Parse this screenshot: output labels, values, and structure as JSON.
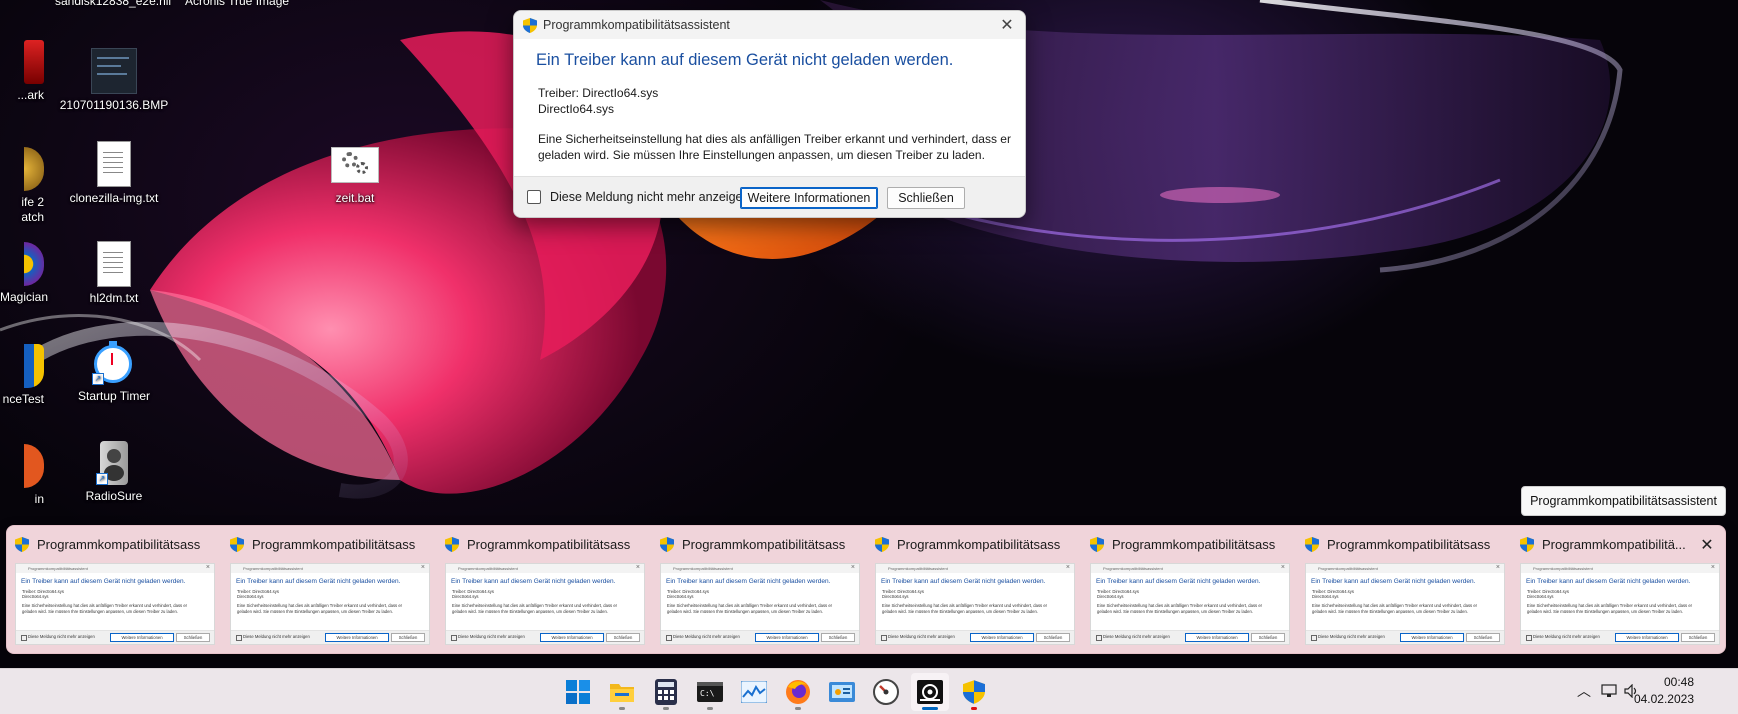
{
  "desktop": {
    "icons": [
      {
        "label": "...ark",
        "kind": "partial-red"
      },
      {
        "label": "210701190136.BMP",
        "kind": "bmp"
      },
      {
        "label": "ife 2\natch",
        "kind": "partial-gold"
      },
      {
        "label": "clonezilla-img.txt",
        "kind": "txt"
      },
      {
        "label": "zeit.bat",
        "kind": "bat"
      },
      {
        "label": "Magician",
        "kind": "partial-shield"
      },
      {
        "label": "hl2dm.txt",
        "kind": "txt"
      },
      {
        "label": "nceTest",
        "kind": "partial-shield"
      },
      {
        "label": "Startup Timer",
        "kind": "timer"
      },
      {
        "label": "in",
        "kind": "partial-orange"
      },
      {
        "label": "RadioSure",
        "kind": "speaker"
      }
    ],
    "top_partial_labels": [
      "sandisk12838_e2e.hll",
      "Acronis True Image"
    ]
  },
  "dialog": {
    "window_title": "Programmkompatibilitätsassistent",
    "heading": "Ein Treiber kann auf diesem Gerät nicht geladen werden.",
    "driver_line1": "Treiber: DirectIo64.sys",
    "driver_line2": "DirectIo64.sys",
    "message_line1": "Eine Sicherheitseinstellung hat dies als anfälligen Treiber erkannt und verhindert, dass er",
    "message_line2": "geladen wird. Sie müssen Ihre Einstellungen anpassen, um diesen Treiber zu laden.",
    "checkbox_label": "Diese Meldung nicht mehr anzeigen",
    "more_info_button": "Weitere Informationen",
    "close_button": "Schließen"
  },
  "tooltip": "Programmkompatibilitätsassistent",
  "flyout": {
    "previews": [
      {
        "title": "Programmkompatibilitätsassist..."
      },
      {
        "title": "Programmkompatibilitätsassist..."
      },
      {
        "title": "Programmkompatibilitätsassist..."
      },
      {
        "title": "Programmkompatibilitätsassist..."
      },
      {
        "title": "Programmkompatibilitätsassist..."
      },
      {
        "title": "Programmkompatibilitätsassist..."
      },
      {
        "title": "Programmkompatibilitätsassist..."
      },
      {
        "title": "Programmkompatibilitä..."
      }
    ],
    "thumb": {
      "bar": "Programmkompatibilitätsassistent",
      "head": "Ein Treiber kann auf diesem Gerät nicht geladen werden.",
      "l1": "Treiber: DirectIo64.sys",
      "l2": "DirectIo64.sys",
      "l3": "Eine Sicherheitseinstellung hat dies als anfälligen Treiber erkannt und verhindert, dass er",
      "l4": "geladen wird. Sie müssen Ihre Einstellungen anpassen, um diesen Treiber zu laden.",
      "chk": "Diese Meldung nicht mehr anzeigen",
      "b1": "Weitere Informationen",
      "b2": "Schließen"
    }
  },
  "taskbar": {
    "apps": [
      {
        "name": "start",
        "icon": "windows-logo-icon"
      },
      {
        "name": "file-explorer",
        "icon": "folder-icon"
      },
      {
        "name": "calculator",
        "icon": "calculator-icon"
      },
      {
        "name": "terminal",
        "icon": "terminal-icon"
      },
      {
        "name": "resource-monitor",
        "icon": "monitor-chart-icon"
      },
      {
        "name": "firefox",
        "icon": "firefox-icon"
      },
      {
        "name": "control-panel",
        "icon": "control-panel-icon"
      },
      {
        "name": "speedometer-app",
        "icon": "gauge-icon"
      },
      {
        "name": "app-active",
        "icon": "app-window-icon"
      },
      {
        "name": "compat-assistant",
        "icon": "shield-icon"
      }
    ],
    "time": "00:48",
    "date": "04.02.2023",
    "accent": "#0067c0"
  }
}
